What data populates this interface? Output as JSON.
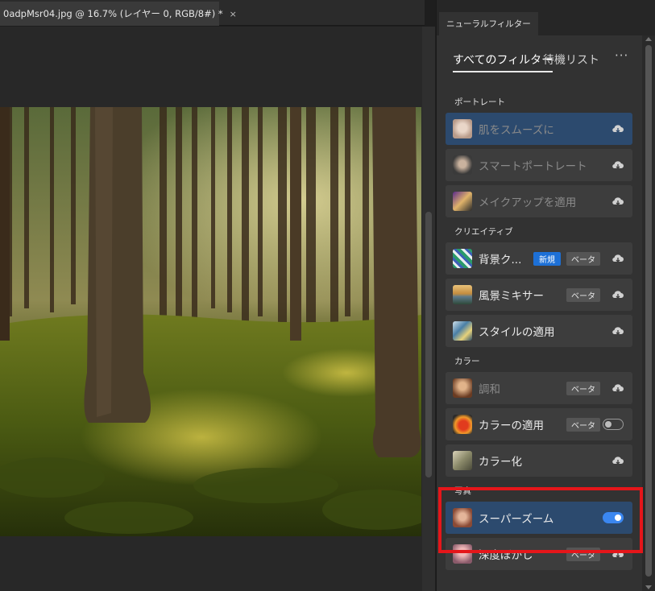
{
  "document": {
    "tab_title": "0adpMsr04.jpg @ 16.7% (レイヤー 0, RGB/8#) *",
    "close_symbol": "×",
    "image_alt": "forest-photo"
  },
  "panel": {
    "title": "ニューラルフィルター",
    "tabs": {
      "all": "すべてのフィルター",
      "waitlist": "待機リスト",
      "more": "···"
    },
    "categories": {
      "portrait": "ポートレート",
      "creative": "クリエイティブ",
      "color": "カラー",
      "photo": "写真"
    },
    "filters": {
      "smooth_skin": "肌をスムーズに",
      "smart_portrait": "スマートポートレート",
      "makeup_transfer": "メイクアップを適用",
      "background_creator": "背景ク...",
      "landscape_mixer": "風景ミキサー",
      "style_transfer": "スタイルの適用",
      "harmonization": "調和",
      "color_transfer": "カラーの適用",
      "colorize": "カラー化",
      "super_zoom": "スーパーズーム",
      "depth_blur": "深度ぼかし"
    },
    "badges": {
      "new": "新規",
      "beta": "ベータ"
    },
    "states": {
      "color_transfer_on": false,
      "super_zoom_on": true
    }
  },
  "colors": {
    "accent": "#3b87f0",
    "highlight": "#e5161a",
    "selected_row": "#2c4a6e"
  }
}
